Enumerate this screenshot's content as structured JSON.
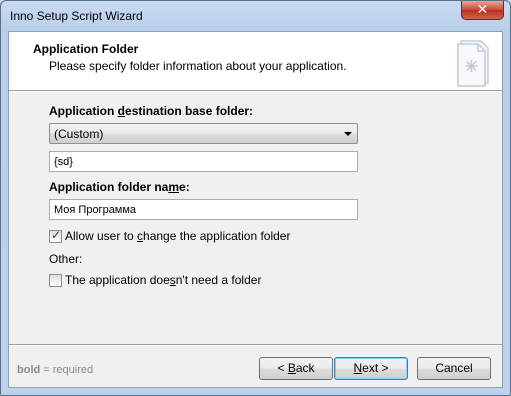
{
  "window": {
    "title": "Inno Setup Script Wizard",
    "close_glyph": "✕"
  },
  "header": {
    "title": "Application Folder",
    "subtitle": "Please specify folder information about your application."
  },
  "base_folder": {
    "label_pre": "Application ",
    "label_accel": "d",
    "label_post": "estination base folder:",
    "selected": "(Custom)",
    "custom_value": "{sd}"
  },
  "folder_name": {
    "label_pre": "Application folder na",
    "label_accel": "m",
    "label_post": "e:",
    "value": "Моя Программа"
  },
  "allow_change": {
    "checked": true,
    "label_pre": "Allow user to ",
    "label_accel": "c",
    "label_post": "hange the application folder"
  },
  "other_label": "Other:",
  "no_folder": {
    "checked": false,
    "label_pre": "The application doe",
    "label_accel": "s",
    "label_post": "n't need a folder"
  },
  "hint": {
    "bold": "bold",
    "rest": " = required"
  },
  "buttons": {
    "back": {
      "pre": "< ",
      "accel": "B",
      "post": "ack"
    },
    "next": {
      "accel": "N",
      "post": "ext >"
    },
    "cancel": "Cancel"
  }
}
